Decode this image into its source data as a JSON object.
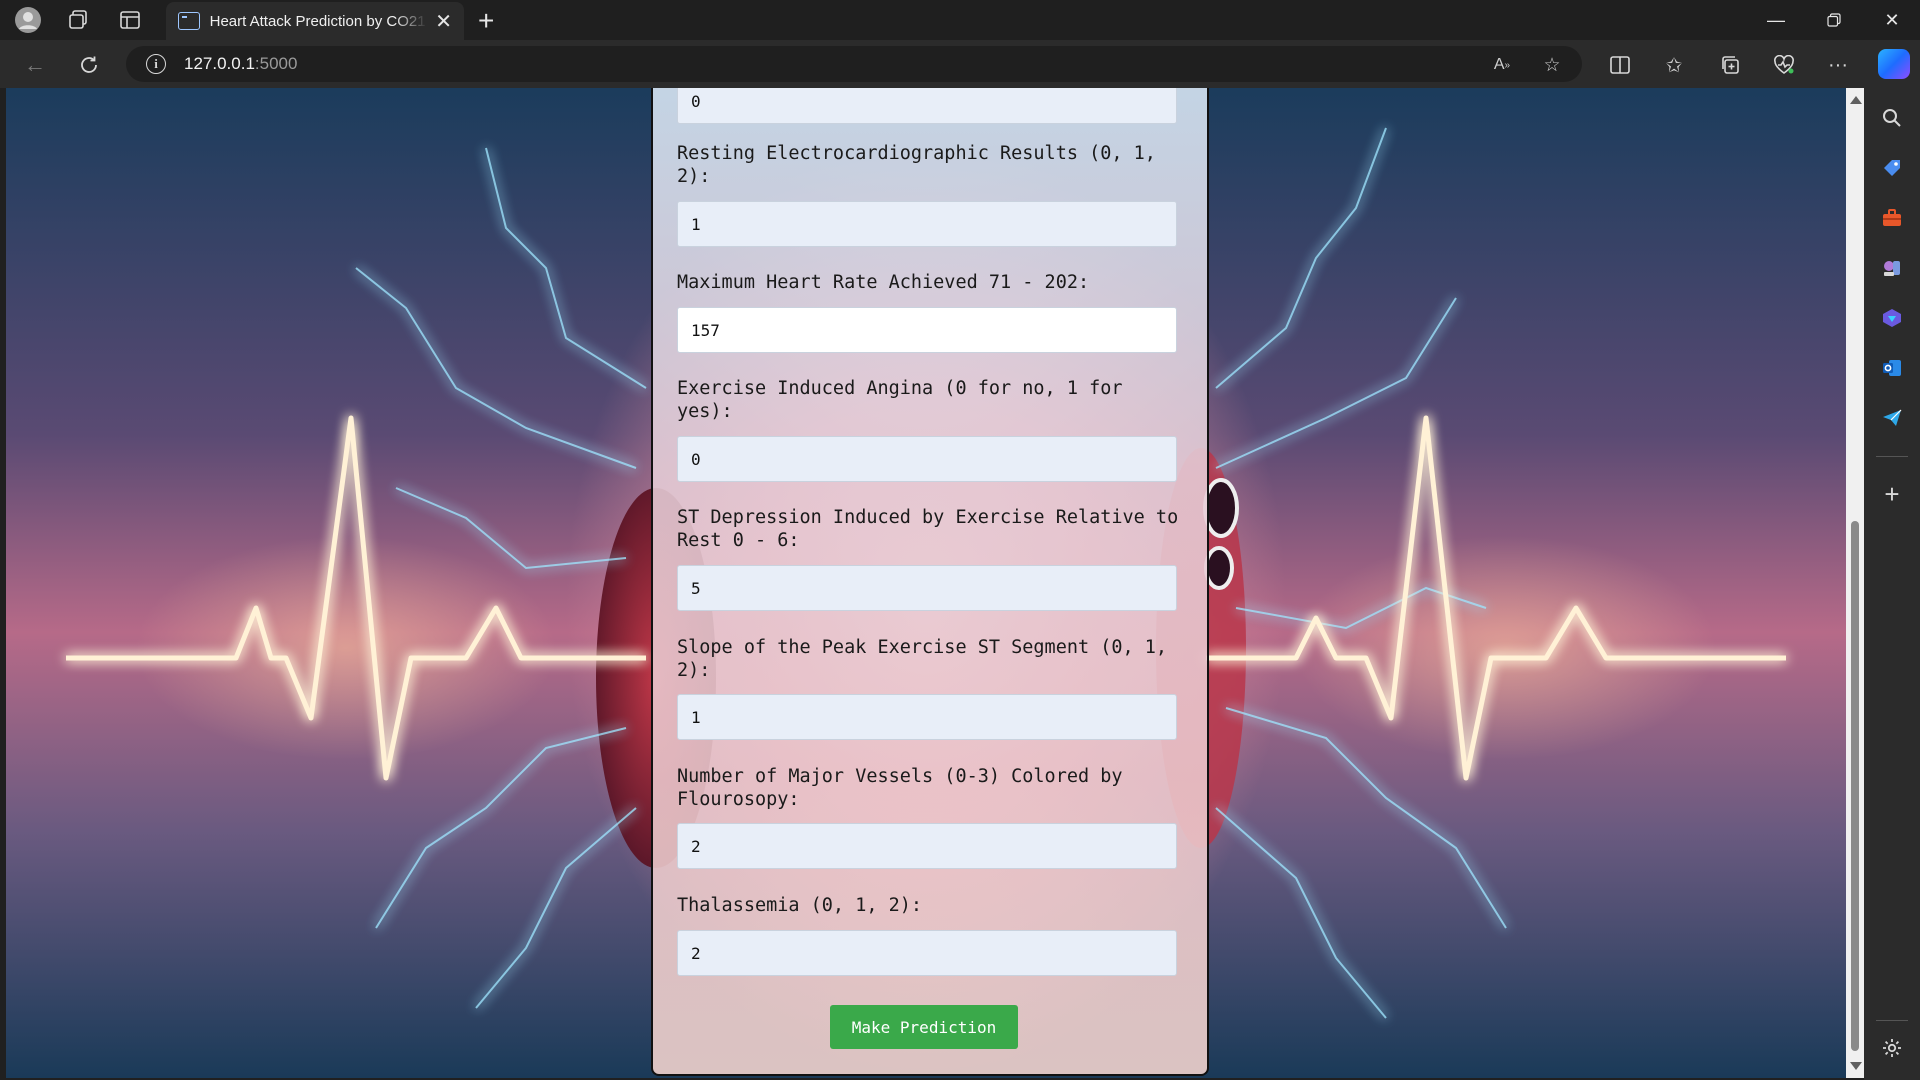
{
  "browser": {
    "tab_title": "Heart Attack Prediction by CO21",
    "url_host": "127.0.0.1",
    "url_port": ":5000"
  },
  "form": {
    "top_value": "0",
    "fields": [
      {
        "label": "Resting Electrocardiographic Results (0, 1, 2):",
        "value": "1"
      },
      {
        "label": "Maximum Heart Rate Achieved 71 - 202:",
        "value": "157"
      },
      {
        "label": "Exercise Induced Angina (0 for no, 1 for yes):",
        "value": "0"
      },
      {
        "label": "ST Depression Induced by Exercise Relative to Rest 0 - 6:",
        "value": "5"
      },
      {
        "label": "Slope of the Peak Exercise ST Segment (0, 1, 2):",
        "value": "1"
      },
      {
        "label": "Number of Major Vessels (0-3) Colored by Flourosopy:",
        "value": "2"
      },
      {
        "label": "Thalassemia (0, 1, 2):",
        "value": "2"
      }
    ],
    "submit_label": "Make Prediction"
  },
  "colors": {
    "submit_button": "#3aa94a",
    "ekg_glow": "#ffd9a0"
  }
}
